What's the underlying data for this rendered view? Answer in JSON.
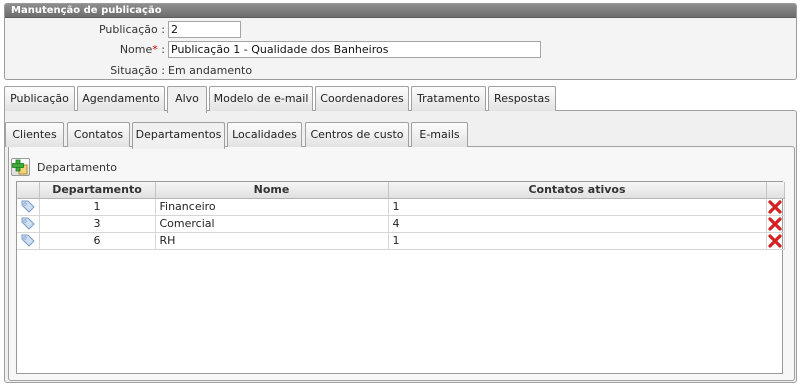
{
  "panel": {
    "title": "Manutenção de publicação"
  },
  "form": {
    "publicacao_label": "Publicação :",
    "publicacao_value": "2",
    "nome_label": "Nome",
    "nome_required": "*",
    "nome_colon": ":",
    "nome_value": "Publicação 1 - Qualidade dos Banheiros",
    "situacao_label": "Situação :",
    "situacao_value": "Em andamento"
  },
  "main_tabs": [
    {
      "label": "Publicação"
    },
    {
      "label": "Agendamento"
    },
    {
      "label": "Alvo",
      "active": true
    },
    {
      "label": "Modelo de e-mail"
    },
    {
      "label": "Coordenadores"
    },
    {
      "label": "Tratamento"
    },
    {
      "label": "Respostas"
    }
  ],
  "sub_tabs": [
    {
      "label": "Clientes"
    },
    {
      "label": "Contatos"
    },
    {
      "label": "Departamentos",
      "active": true
    },
    {
      "label": "Localidades"
    },
    {
      "label": "Centros de custo"
    },
    {
      "label": "E-mails"
    }
  ],
  "toolbar": {
    "add_label": "Departamento",
    "add_icon": "add-icon"
  },
  "grid": {
    "columns": [
      "Departamento",
      "Nome",
      "Contatos ativos"
    ],
    "rows": [
      {
        "departamento": "1",
        "nome": "Financeiro",
        "contatos": "1"
      },
      {
        "departamento": "3",
        "nome": "Comercial",
        "contatos": "4"
      },
      {
        "departamento": "6",
        "nome": "RH",
        "contatos": "1"
      }
    ],
    "row_icon": "tag-icon",
    "delete_icon": "delete-icon"
  },
  "colors": {
    "header_bar": "#7a7a7a",
    "required": "#d00000",
    "delete": "#d42020",
    "add": "#2e9b2e"
  }
}
